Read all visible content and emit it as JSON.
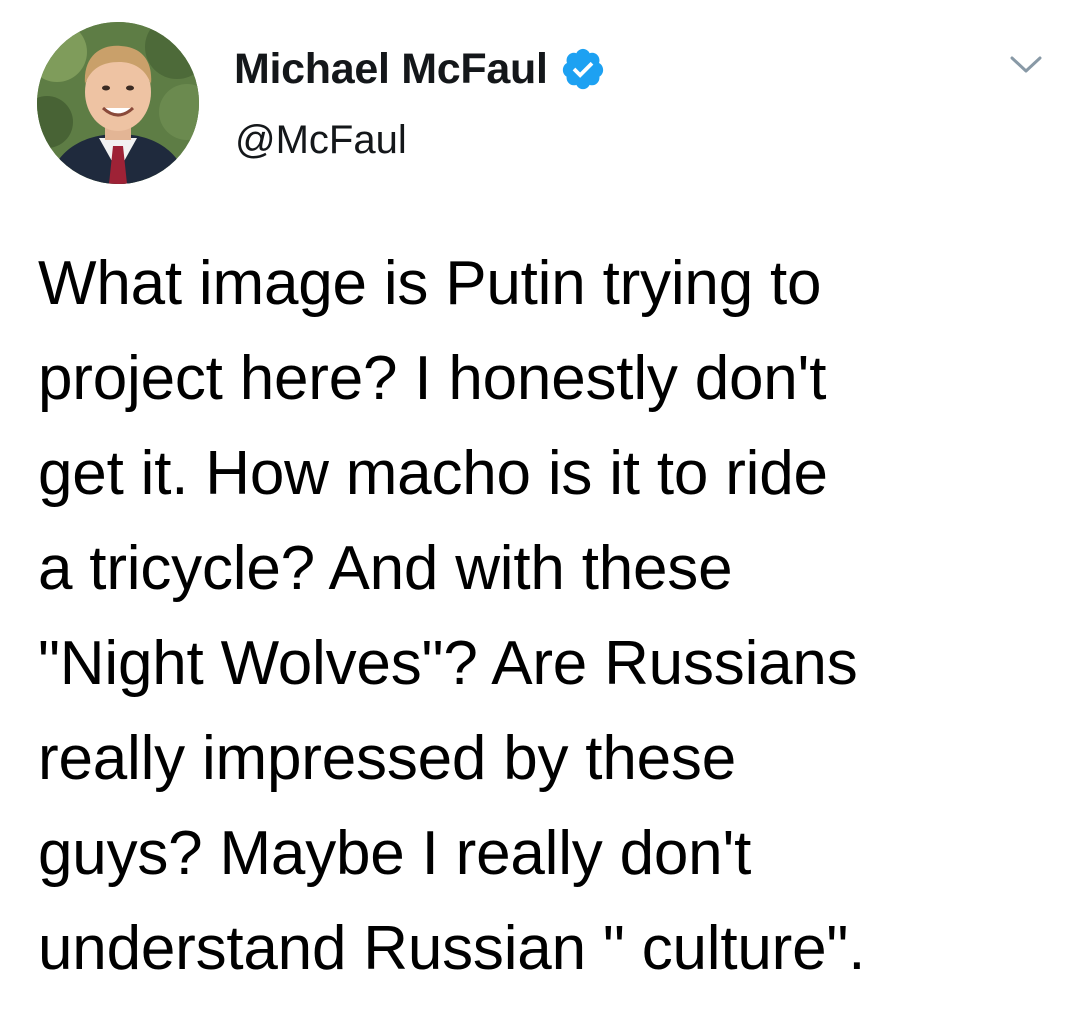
{
  "user": {
    "display_name": "Michael McFaul",
    "handle": "@McFaul",
    "verified": true,
    "avatar_icon": "profile-photo"
  },
  "menu": {
    "icon": "chevron-down-icon"
  },
  "tweet": {
    "text": "What image is Putin trying to\nproject here? I honestly don't\nget it. How macho is it to ride\na tricycle? And with these\n\"Night Wolves\"? Are Russians\nreally impressed by these\nguys? Maybe I really don't\nunderstand Russian \" culture\"."
  },
  "colors": {
    "verified_badge": "#1da1f2",
    "caret": "#8899a6",
    "text": "#14171a"
  }
}
